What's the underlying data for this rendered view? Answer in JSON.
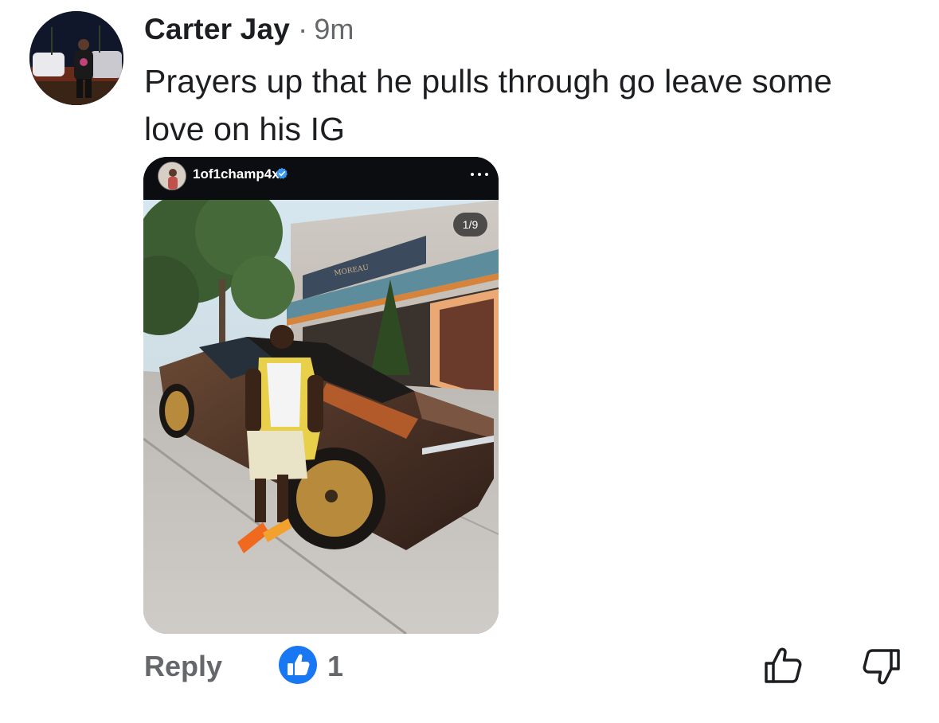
{
  "comment": {
    "author": "Carter Jay",
    "separator": "·",
    "timestamp": "9m",
    "text": "Prayers up that he pulls through go leave some love on his IG"
  },
  "embed": {
    "username": "1of1champ4x",
    "verified": true,
    "page_counter": "1/9",
    "more_icon": "more-horizontal-icon",
    "photo_description_icon": "photo"
  },
  "actions": {
    "reply_label": "Reply",
    "like_count": "1",
    "like_badge_icon": "thumbs-up-filled-icon",
    "thumbs_up_icon": "thumbs-up-outline-icon",
    "thumbs_down_icon": "thumbs-down-outline-icon"
  },
  "colors": {
    "text_primary": "#1c1e21",
    "text_secondary": "#65676b",
    "like_blue": "#1877f2",
    "verified_blue": "#3897f0"
  }
}
